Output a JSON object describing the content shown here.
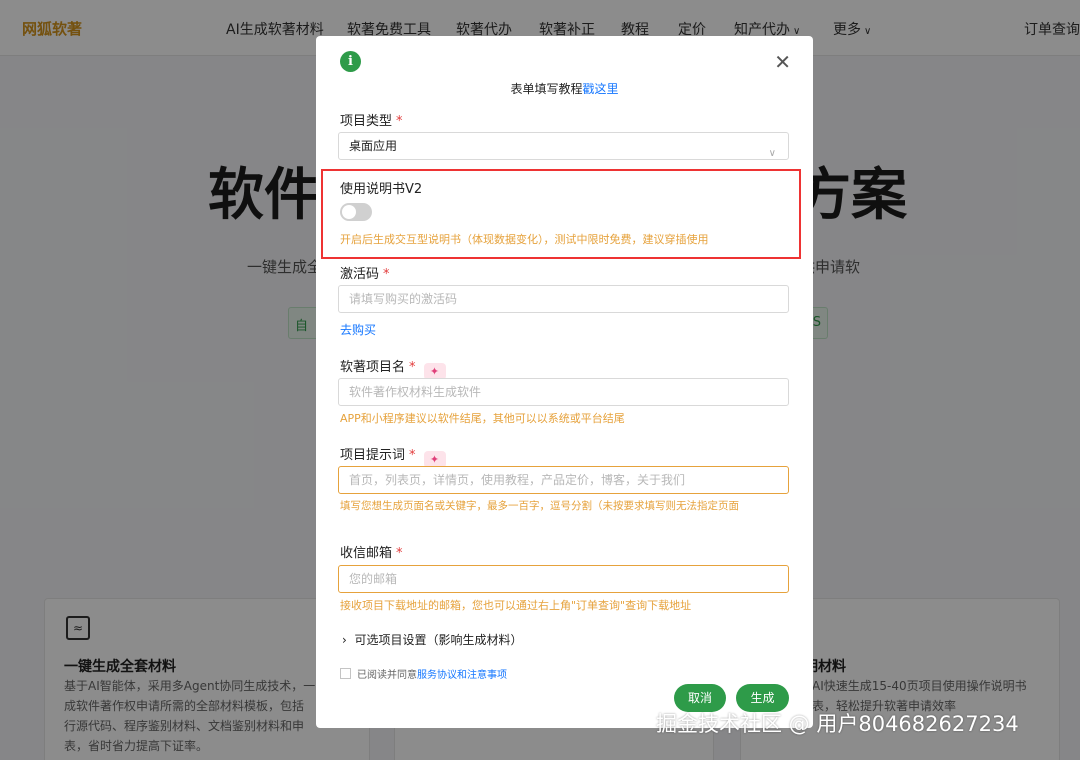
{
  "nav": {
    "logo": "网狐软著",
    "items": [
      "AI生成软著材料",
      "软著免费工具",
      "软著代办",
      "软著补正",
      "教程",
      "定价",
      "知产代办",
      "更多"
    ],
    "right": "订单查询"
  },
  "hero": {
    "title_left": "软件",
    "title_right": "方案",
    "sub_left": "一键生成全",
    "sub_right": "供申请软",
    "btn_left": "自动",
    "btn_right": "S"
  },
  "cards": {
    "left_title": "一键生成全套材料",
    "left_lines": [
      "基于AI智能体，采用多Agent协同生成技术，一",
      "成软件著作权申请所需的全部材料模板，包括",
      "行源代码、程序鉴别材料、文档鉴别材料和申",
      "表，省时省力提高下证率。"
    ],
    "right_title": "明材料",
    "right_lines": [
      "，AI快速生成15-40页项目使用操作说明书",
      "程表，轻松提升软著申请效率"
    ]
  },
  "modal": {
    "info_icon": "i",
    "close_icon": "✕",
    "tutorial_text": "表单填写教程",
    "tutorial_link": "戳这里",
    "project_type": {
      "label": "项目类型",
      "required": "*",
      "value": "桌面应用"
    },
    "manual_v2": {
      "label": "使用说明书V2",
      "hint": "开启后生成交互型说明书（体现数据变化），测试中限时免费，建议穿插使用",
      "on": false
    },
    "activation": {
      "label": "激活码",
      "required": "*",
      "placeholder": "请填写购买的激活码",
      "buy_link": "去购买"
    },
    "project_name": {
      "label": "软著项目名",
      "required": "*",
      "placeholder": "软件著作权材料生成软件",
      "hint": "APP和小程序建议以软件结尾，其他可以以系统或平台结尾"
    },
    "prompt": {
      "label": "项目提示词",
      "required": "*",
      "placeholder": "首页，列表页，详情页，使用教程，产品定价，博客，关于我们",
      "hint": "填写您想生成页面名或关键字，最多一百字，逗号分割（未按要求填写则无法指定页面"
    },
    "email": {
      "label": "收信邮箱",
      "required": "*",
      "placeholder": "您的邮箱",
      "hint": "接收项目下载地址的邮箱，您也可以通过右上角\"订单查询\"查询下载地址"
    },
    "optional": "可选项目设置（影响生成材料）",
    "agree_text": "已阅读并同意",
    "agree_link": "服务协议和注意事项",
    "cancel": "取消",
    "generate": "生成"
  },
  "watermark": "掘金技术社区 @ 用户804682627234",
  "colors": {
    "accent": "#2e9b49",
    "warning": "#e6a23c",
    "link": "#1677ff",
    "highlight": "#e33333"
  }
}
